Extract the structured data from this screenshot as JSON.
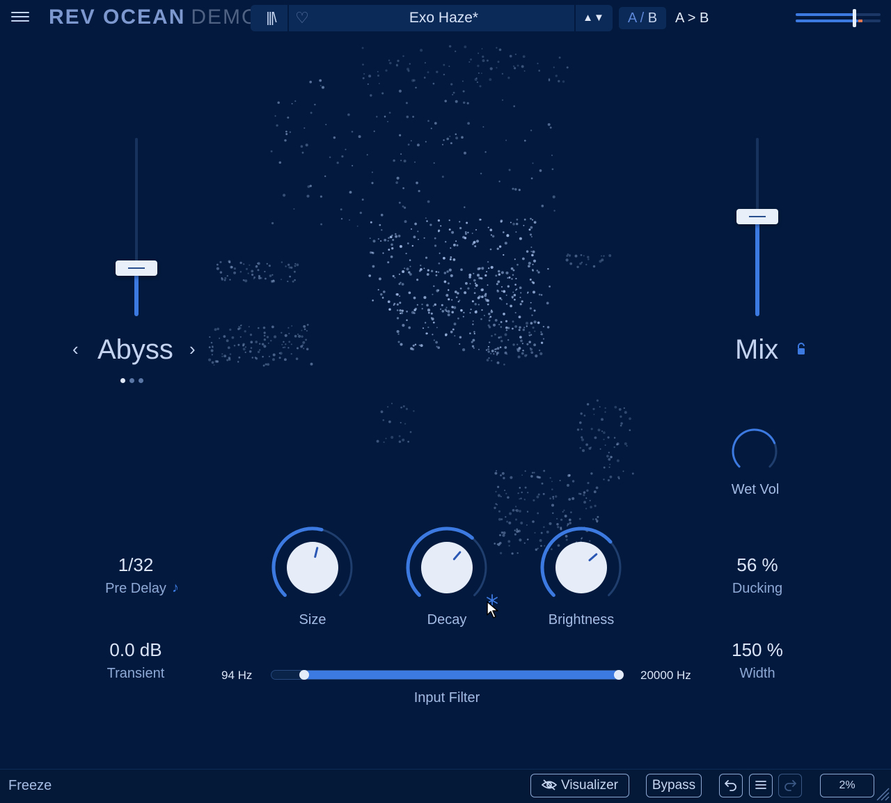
{
  "header": {
    "brand": "REV OCEAN",
    "brand_suffix": "DEMO",
    "preset_name": "Exo Haze*",
    "preset_nav": "▲▼",
    "ab_a": "A",
    "ab_sep": " / ",
    "ab_b": "B",
    "ab_copy": "A > B",
    "output_meter_level": 0.7
  },
  "mode": {
    "name": "Abyss",
    "slider_level": 0.27,
    "pages": 3,
    "active_page": 0
  },
  "mix": {
    "label": "Mix",
    "slider_level": 0.56
  },
  "wet_vol": {
    "label": "Wet Vol",
    "level": 0.75
  },
  "pre_delay": {
    "value": "1/32",
    "label": "Pre Delay"
  },
  "transient": {
    "value": "0.0 dB",
    "label": "Transient"
  },
  "ducking": {
    "value": "56 %",
    "label": "Ducking"
  },
  "width": {
    "value": "150 %",
    "label": "Width"
  },
  "knobs": {
    "size": {
      "label": "Size",
      "level": 0.55
    },
    "decay": {
      "label": "Decay",
      "level": 0.65
    },
    "brightness": {
      "label": "Brightness",
      "level": 0.68
    }
  },
  "input_filter": {
    "label": "Input Filter",
    "low": "94 Hz",
    "high": "20000 Hz"
  },
  "footer": {
    "freeze": "Freeze",
    "visualizer": "Visualizer",
    "bypass": "Bypass",
    "zoom": "2%"
  },
  "colors": {
    "background": "#031a3e",
    "accent": "#3c79e0",
    "peak": "#e2764f",
    "particles": "#a9c3ef"
  }
}
